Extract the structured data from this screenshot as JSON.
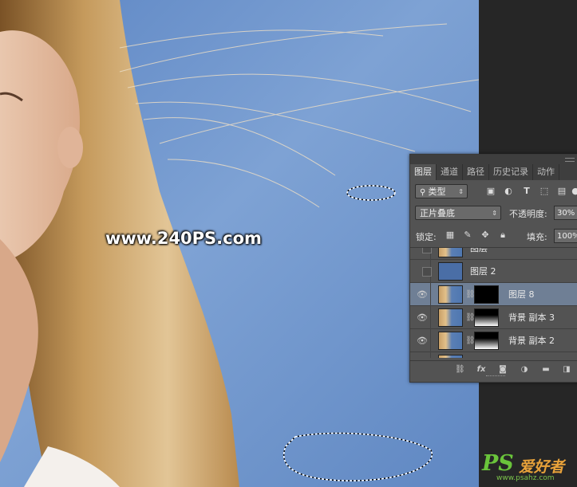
{
  "watermark": "www.240PS.com",
  "logo": {
    "text": "PS",
    "chinese": "爱好者",
    "url": "www.psahz.com"
  },
  "panel": {
    "tabs": [
      "图层",
      "通道",
      "路径",
      "历史记录",
      "动作"
    ],
    "filter": {
      "label": "类型",
      "search_icon": "search-icon"
    },
    "blend_mode": "正片叠底",
    "opacity_label": "不透明度:",
    "opacity_value": "30%",
    "lock_label": "锁定:",
    "fill_label": "填充:",
    "fill_value": "100%",
    "layers": [
      {
        "name": "图层",
        "visible": false,
        "partial": true
      },
      {
        "name": "图层 2",
        "visible": false
      },
      {
        "name": "图层 8",
        "visible": true,
        "selected": true
      },
      {
        "name": "背景 副本 3",
        "visible": true
      },
      {
        "name": "背景 副本 2",
        "visible": true
      }
    ]
  },
  "colors": {
    "sky": "#6f95cc",
    "panel_bg": "#535353",
    "selected_layer": "#6f7f95",
    "logo_green": "#6ac43b"
  }
}
